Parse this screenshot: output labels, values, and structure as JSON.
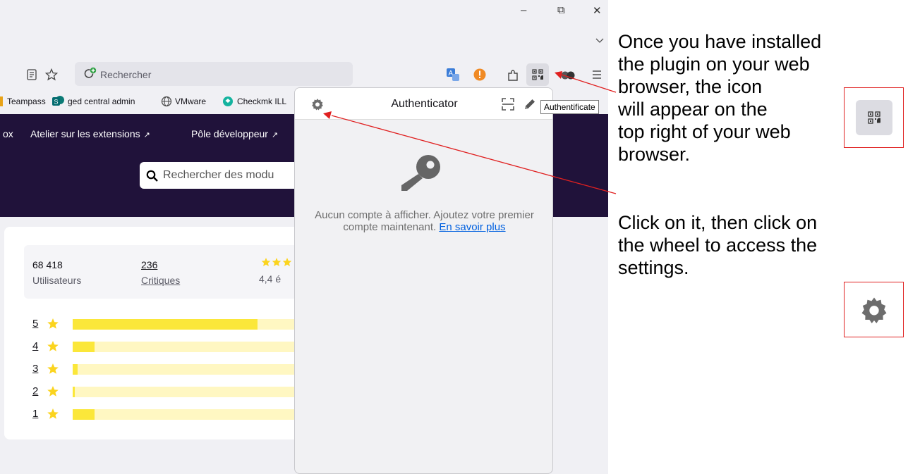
{
  "browser": {
    "window_controls": {
      "minimize": "–",
      "restore": "⧉",
      "close": "✕"
    },
    "tab_overflow_icon": "chevron-down-icon",
    "toolbar": {
      "url_placeholder": "Rechercher",
      "reader_icon": "reader-view-icon",
      "bookmark_icon": "star-icon"
    },
    "bookmarks": [
      "Teampass",
      "ged central admin",
      "VMware",
      "Checkmk ILL"
    ],
    "tooltip": "Authentificate"
  },
  "page": {
    "hero_links": [
      "ox",
      "Atelier sur les extensions",
      "Pôle développeur"
    ],
    "search_placeholder": "Rechercher des modu",
    "stats": {
      "users_value": "68 418",
      "users_label": "Utilisateurs",
      "reviews_value": "236",
      "reviews_label": "Critiques",
      "rating_text": "4,4 é"
    },
    "ratings": [
      {
        "label": "5",
        "fraction": 0.77
      },
      {
        "label": "4",
        "fraction": 0.09
      },
      {
        "label": "3",
        "fraction": 0.02
      },
      {
        "label": "2",
        "fraction": 0.01
      },
      {
        "label": "1",
        "fraction": 0.09
      }
    ]
  },
  "popup": {
    "title": "Authenticator",
    "empty_message": "Aucun compte à afficher. Ajoutez votre premier compte maintenant.",
    "learn_more_link": "En savoir plus"
  },
  "annotations": {
    "line1": "Once you have installed",
    "line2": "the plugin on your web",
    "line3": "browser, the icon",
    "line4": "will appear on the",
    "line5": "top right of your web",
    "line6": "browser.",
    "line7": "Click on it, then click on",
    "line8": "the wheel to access the",
    "line9": "settings."
  },
  "colors": {
    "hero_bg": "#20123a",
    "bar_fill": "#fbe73a",
    "bar_track": "#fff7c2",
    "annotation_red": "#e02020",
    "link_blue": "#0060df"
  }
}
